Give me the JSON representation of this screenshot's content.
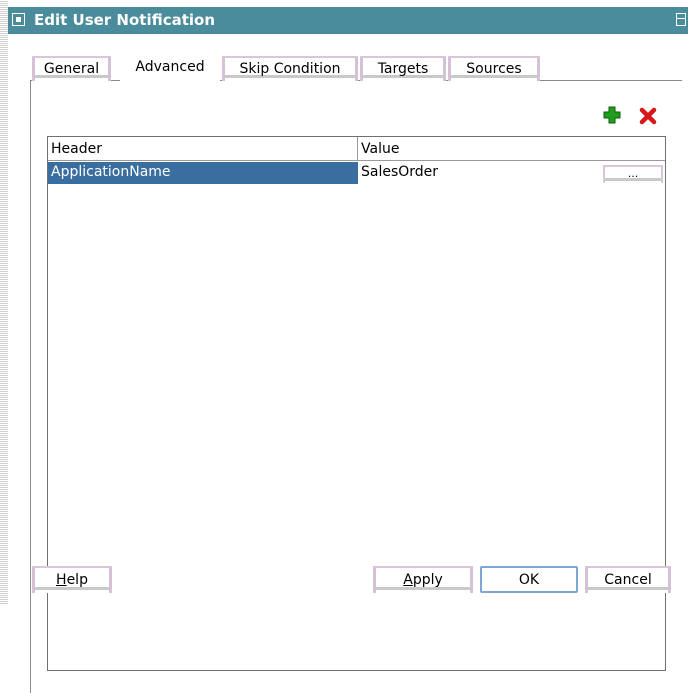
{
  "window": {
    "title": "Edit User Notification"
  },
  "tabs": [
    {
      "label": "General",
      "active": false
    },
    {
      "label": "Advanced",
      "active": true
    },
    {
      "label": "Skip Condition",
      "active": false
    },
    {
      "label": "Targets",
      "active": false
    },
    {
      "label": "Sources",
      "active": false
    }
  ],
  "toolbar": {
    "add_icon": "plus-icon",
    "remove_icon": "x-icon",
    "add_color": "#1e9e1e",
    "remove_color": "#d81818"
  },
  "table": {
    "columns": [
      "Header",
      "Value"
    ],
    "rows": [
      {
        "header": "ApplicationName",
        "value": "SalesOrder",
        "selected": true,
        "button_label": "..."
      }
    ]
  },
  "buttons": {
    "help": {
      "accel": "H",
      "rest": "elp"
    },
    "apply": {
      "accel": "A",
      "rest": "pply"
    },
    "ok": "OK",
    "cancel": "Cancel"
  },
  "colors": {
    "titlebar": "#4a8c9c",
    "selection": "#3a6ea0"
  }
}
